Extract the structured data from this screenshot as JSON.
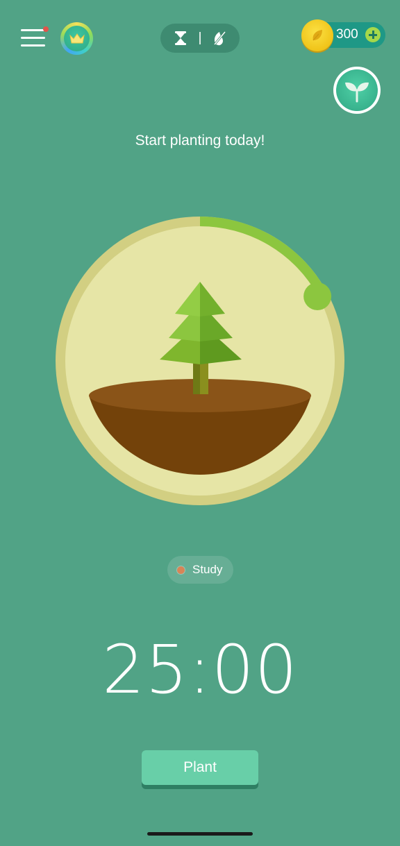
{
  "header": {
    "coin_count": "300",
    "icons": {
      "menu": "menu-icon",
      "crown": "crown-icon",
      "hourglass": "hourglass-icon",
      "no_phone": "no-phone-icon",
      "coin": "coin-icon",
      "plus": "plus-icon",
      "sprout": "sprout-icon"
    }
  },
  "main": {
    "tagline": "Start planting today!",
    "progress_fraction": 0.17,
    "tag": {
      "label": "Study",
      "color": "#d78557"
    },
    "timer": "25:00",
    "plant_button_label": "Plant"
  },
  "colors": {
    "background": "#51a386",
    "progress": "#8cc63f",
    "ring": "#d2cf82",
    "dish": "#e6e5a6",
    "soil": "#73420a",
    "button": "#68cfa8"
  }
}
